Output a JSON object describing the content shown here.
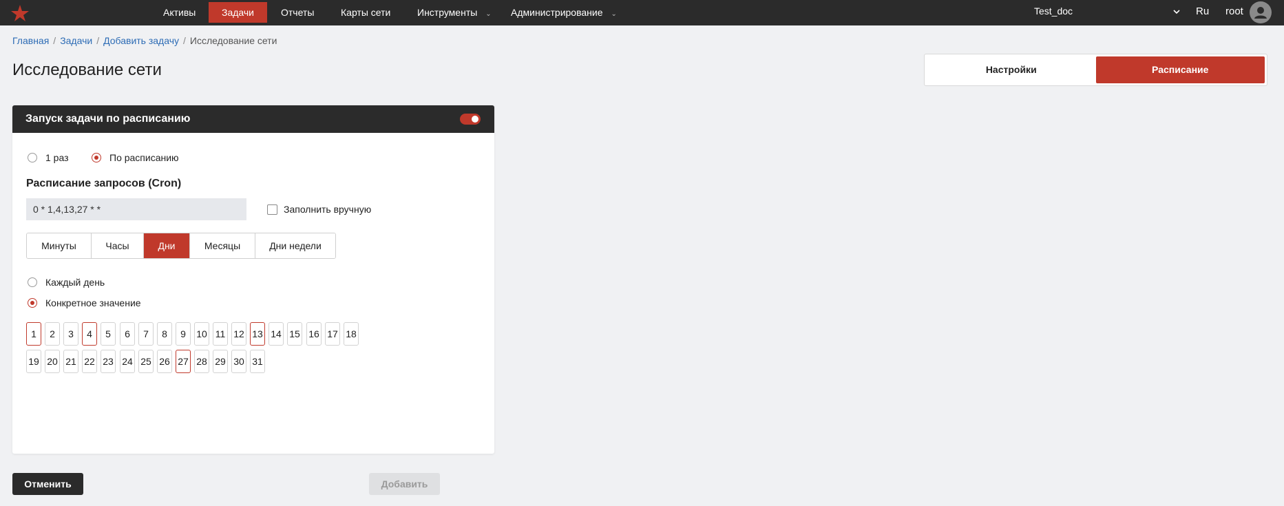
{
  "nav": {
    "items": [
      {
        "label": "Активы"
      },
      {
        "label": "Задачи",
        "active": true
      },
      {
        "label": "Отчеты"
      },
      {
        "label": "Карты сети"
      },
      {
        "label": "Инструменты",
        "has_dropdown": true
      },
      {
        "label": "Администрирование",
        "has_dropdown": true
      }
    ],
    "document": "Test_doc",
    "language": "Ru",
    "user": "root"
  },
  "breadcrumb": {
    "items": [
      "Главная",
      "Задачи",
      "Добавить задачу"
    ],
    "current": "Исследование сети"
  },
  "page": {
    "title": "Исследование сети"
  },
  "mode_switch": {
    "settings_label": "Настройки",
    "schedule_label": "Расписание",
    "active": "schedule"
  },
  "card": {
    "header": "Запуск задачи по расписанию",
    "enabled": true,
    "run_mode": {
      "once_label": "1 раз",
      "scheduled_label": "По расписанию",
      "selected": "scheduled"
    },
    "cron_title": "Расписание запросов (Cron)",
    "cron_value": "0 * 1,4,13,27 * *",
    "manual_label": "Заполнить вручную",
    "manual_checked": false,
    "tabs": [
      "Минуты",
      "Часы",
      "Дни",
      "Месяцы",
      "Дни недели"
    ],
    "active_tab": "Дни",
    "day_mode": {
      "every_label": "Каждый день",
      "specific_label": "Конкретное значение",
      "selected": "specific"
    },
    "days": [
      "1",
      "2",
      "3",
      "4",
      "5",
      "6",
      "7",
      "8",
      "9",
      "10",
      "11",
      "12",
      "13",
      "14",
      "15",
      "16",
      "17",
      "18",
      "19",
      "20",
      "21",
      "22",
      "23",
      "24",
      "25",
      "26",
      "27",
      "28",
      "29",
      "30",
      "31"
    ],
    "selected_days": [
      "1",
      "4",
      "13",
      "27"
    ]
  },
  "actions": {
    "cancel_label": "Отменить",
    "add_label": "Добавить"
  },
  "colors": {
    "accent": "#c0392b",
    "dark": "#2b2b2b",
    "link": "#2d6cb5"
  }
}
